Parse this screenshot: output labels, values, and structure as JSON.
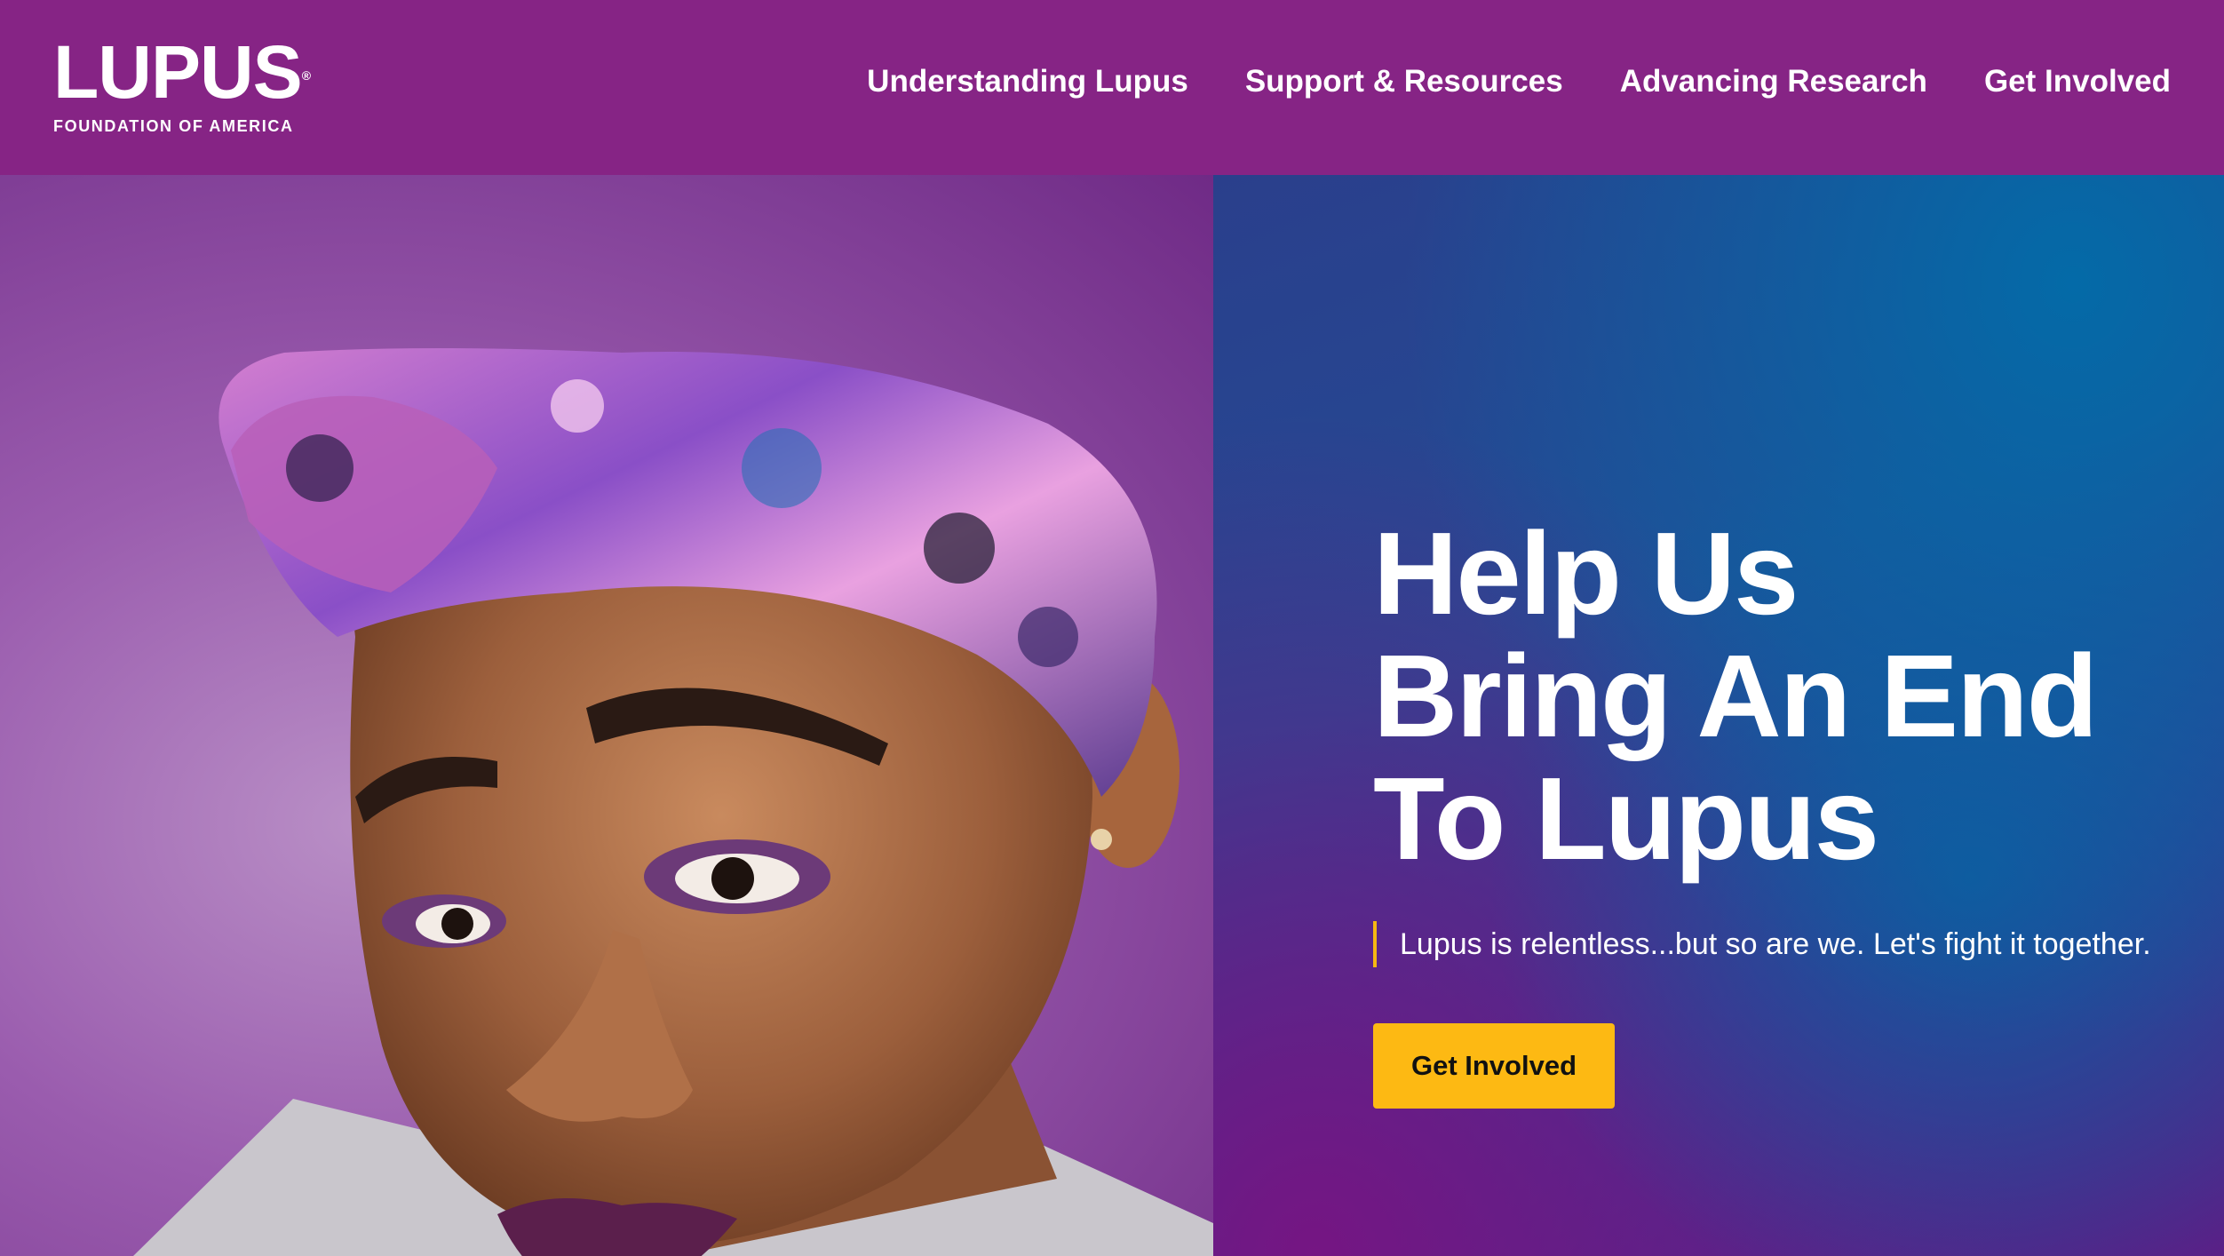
{
  "brand": {
    "logo_word": "LUPUS",
    "logo_registered": "®",
    "logo_sub": "FOUNDATION OF AMERICA"
  },
  "nav": {
    "items": [
      {
        "label": "Understanding Lupus"
      },
      {
        "label": "Support & Resources"
      },
      {
        "label": "Advancing Research"
      },
      {
        "label": "Get Involved"
      }
    ]
  },
  "hero": {
    "title_lines": [
      "Help Us",
      "Bring An End",
      "To Lupus"
    ],
    "tagline": "Lupus is relentless...but so are we. Let's fight it together.",
    "cta_label": "Get Involved",
    "image_subject": "woman-with-floral-headwrap-portrait"
  },
  "colors": {
    "header_bg": "#862485",
    "cta_bg": "#fdb913",
    "tagline_rule": "#f6b712",
    "hero_blue": "#244b94",
    "hero_purple": "#5b1f86"
  }
}
